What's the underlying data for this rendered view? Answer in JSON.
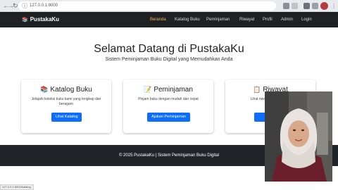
{
  "browser": {
    "url": "127.0.0.1:8000",
    "icons": [
      "back-icon",
      "forward-icon",
      "reload-icon",
      "info-icon",
      "kebab-menu-icon"
    ]
  },
  "navbar": {
    "brand": "PustakaKu",
    "brand_icon": "books-icon",
    "links": [
      {
        "label": "Beranda",
        "active": true
      },
      {
        "label": "Katalog Buku",
        "active": false
      },
      {
        "label": "Peminjaman",
        "active": false
      },
      {
        "label": "Riwayat",
        "active": false
      },
      {
        "label": "Profil",
        "active": false
      },
      {
        "label": "Admin",
        "active": false
      },
      {
        "label": "Login",
        "active": false
      }
    ],
    "active_color": "#f0b85a"
  },
  "hero": {
    "title": "Selamat Datang di PustakaKu",
    "subtitle": "Sistem Peminjaman Buku Digital yang Memudahkan Anda"
  },
  "cards": [
    {
      "icon": "books-icon",
      "title": "Katalog Buku",
      "text": "Jelajahi koleksi buku kami yang lengkap dan beragam",
      "button": "Lihat Katalog"
    },
    {
      "icon": "memo-icon",
      "title": "Peminjaman",
      "text": "Pinjam buku dengan mudah dan cepat",
      "button": "Ajukan Peminjaman"
    },
    {
      "icon": "clipboard-icon",
      "title": "Riwayat",
      "text": "Lihat riwayat peminjaman",
      "button": "Lihat"
    }
  ],
  "footer": {
    "text": "© 2025 PustakaKu | Sistem Peminjaman Buku Digital"
  },
  "status": {
    "text": "127.0.0.1:8000/katalog"
  },
  "colors": {
    "primary": "#0d6efd",
    "navbar_bg": "#1f2123",
    "footer_bg": "#212529"
  }
}
